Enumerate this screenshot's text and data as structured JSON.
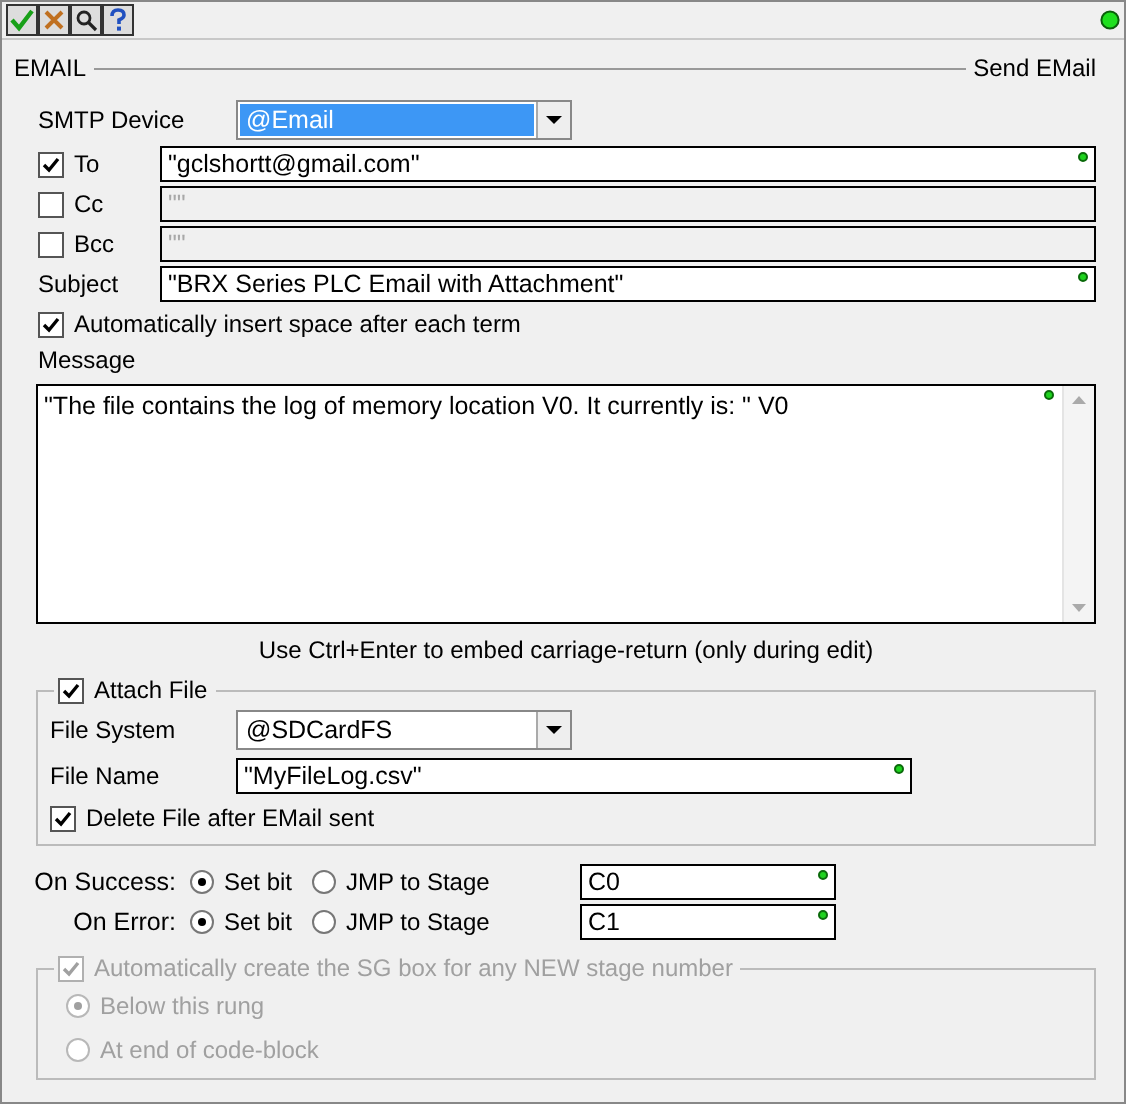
{
  "header": {
    "title": "EMAIL",
    "subtitle": "Send EMail"
  },
  "smtp_device": {
    "label": "SMTP Device",
    "value": "@Email"
  },
  "recipients": [
    {
      "label": "To",
      "checked": true,
      "value": "\"gclshortt@gmail.com\""
    },
    {
      "label": "Cc",
      "checked": false,
      "value": "\"\""
    },
    {
      "label": "Bcc",
      "checked": false,
      "value": "\"\""
    }
  ],
  "subject": {
    "label": "Subject",
    "value": "\"BRX Series PLC Email with Attachment\""
  },
  "auto_space": {
    "label": "Automatically insert space after each term",
    "checked": true
  },
  "message": {
    "label": "Message",
    "value": "\"The file contains the log of memory location V0. It currently is: \" V0",
    "hint": "Use Ctrl+Enter to embed carriage-return (only during edit)"
  },
  "attach": {
    "label": "Attach File",
    "checked": true,
    "file_system": {
      "label": "File System",
      "value": "@SDCardFS"
    },
    "file_name": {
      "label": "File Name",
      "value": "\"MyFileLog.csv\""
    },
    "delete_after": {
      "label": "Delete File after EMail sent",
      "checked": true
    }
  },
  "outcomes": [
    {
      "label": "On Success:",
      "options": [
        {
          "label": "Set bit",
          "selected": true
        },
        {
          "label": "JMP to Stage",
          "selected": false
        }
      ],
      "value": "C0"
    },
    {
      "label": "On Error:",
      "options": [
        {
          "label": "Set bit",
          "selected": true
        },
        {
          "label": "JMP to Stage",
          "selected": false
        }
      ],
      "value": "C1"
    }
  ],
  "sg_box": {
    "label": "Automatically create the SG box for any NEW stage number",
    "checked": true,
    "disabled": true,
    "options": [
      {
        "label": "Below this rung",
        "selected": true
      },
      {
        "label": "At end of code-block",
        "selected": false
      }
    ]
  }
}
